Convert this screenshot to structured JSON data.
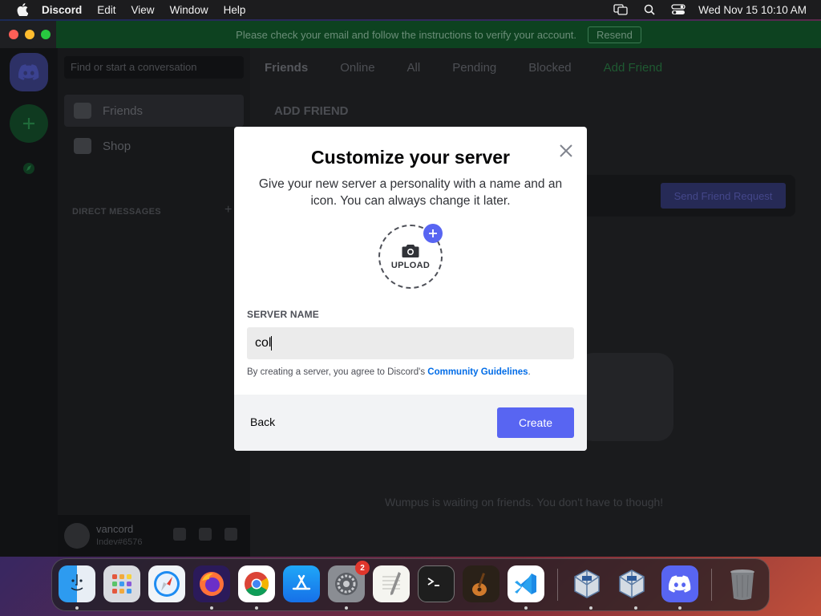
{
  "menubar": {
    "app_name": "Discord",
    "menus": [
      "Edit",
      "View",
      "Window",
      "Help"
    ],
    "clock": "Wed Nov 15  10:10 AM"
  },
  "banner": {
    "text": "Please check your email and follow the instructions to verify your account.",
    "resend_label": "Resend"
  },
  "sidebar": {
    "search_placeholder": "Find or start a conversation",
    "items": [
      {
        "label": "Friends",
        "icon": "friends-icon"
      },
      {
        "label": "Shop",
        "icon": "shop-icon"
      }
    ],
    "direct_messages_heading": "DIRECT MESSAGES",
    "user": {
      "name": "vancord",
      "tag": "Indev#6576"
    }
  },
  "main": {
    "header_title": "Friends",
    "tabs": [
      "Online",
      "All",
      "Pending",
      "Blocked",
      "Add Friend"
    ],
    "add_friend_title": "ADD FRIEND",
    "send_request_label": "Send Friend Request",
    "empty_text": "Wumpus is waiting on friends. You don't have to though!"
  },
  "modal": {
    "title": "Customize your server",
    "subtitle": "Give your new server a personality with a name and an icon. You can always change it later.",
    "upload_label": "UPLOAD",
    "server_name_label": "SERVER NAME",
    "server_name_value": "col",
    "terms_prefix": "By creating a server, you agree to Discord's ",
    "terms_link": "Community Guidelines",
    "terms_suffix": ".",
    "back_label": "Back",
    "create_label": "Create"
  },
  "dock": {
    "apps": [
      {
        "name": "Finder",
        "icon": "finder-icon"
      },
      {
        "name": "Launchpad",
        "icon": "launchpad-icon"
      },
      {
        "name": "Safari",
        "icon": "safari-icon"
      },
      {
        "name": "Firefox",
        "icon": "firefox-icon"
      },
      {
        "name": "Chrome",
        "icon": "chrome-icon"
      },
      {
        "name": "App Store",
        "icon": "app-store-icon"
      },
      {
        "name": "System Settings",
        "icon": "settings-icon",
        "badge": "2"
      },
      {
        "name": "TextEdit",
        "icon": "textedit-icon"
      },
      {
        "name": "Terminal",
        "icon": "terminal-icon"
      },
      {
        "name": "GarageBand",
        "icon": "garageband-icon"
      },
      {
        "name": "Visual Studio Code",
        "icon": "vscode-icon"
      },
      {
        "name": "VirtualBox",
        "icon": "virtualbox-icon"
      },
      {
        "name": "VirtualBox VM",
        "icon": "virtualbox-vm-icon"
      },
      {
        "name": "Discord",
        "icon": "discord-icon"
      },
      {
        "name": "Trash",
        "icon": "trash-icon"
      }
    ]
  },
  "colors": {
    "blurple": "#5865f2",
    "link": "#006ce7",
    "banner_green": "#0d4220"
  }
}
